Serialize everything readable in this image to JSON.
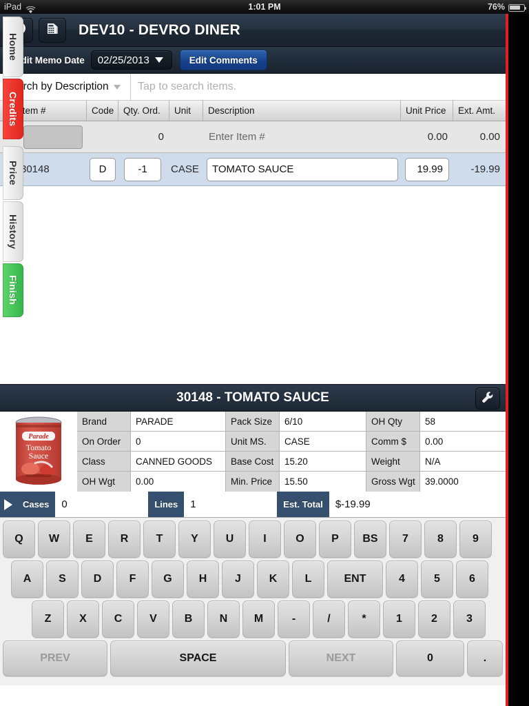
{
  "status_bar": {
    "carrier": "iPad",
    "wifi_icon": "wifi-icon",
    "time": "1:01 PM",
    "battery_percent": "76%",
    "battery_icon": "battery-icon"
  },
  "title_bar": {
    "info_icon": "info-icon",
    "calculator_icon": "calculator-icon",
    "title": "DEV10 - DEVRO DINER"
  },
  "sub_bar": {
    "date_label": "Credit Memo Date",
    "date_value": "02/25/2013",
    "dropdown_icon": "chevron-down-icon",
    "edit_comments_label": "Edit Comments"
  },
  "search": {
    "mode_label": "Search by Description",
    "mode_dropdown_icon": "chevron-down-icon",
    "placeholder": "Tap to search items.",
    "value": ""
  },
  "grid": {
    "columns": [
      {
        "key": "icon",
        "label": ""
      },
      {
        "key": "item",
        "label": "Item #"
      },
      {
        "key": "code",
        "label": "Code"
      },
      {
        "key": "qty",
        "label": "Qty. Ord."
      },
      {
        "key": "unit",
        "label": "Unit"
      },
      {
        "key": "desc",
        "label": "Description"
      },
      {
        "key": "price",
        "label": "Unit Price"
      },
      {
        "key": "ext",
        "label": "Ext. Amt."
      }
    ],
    "entry_row": {
      "item": "",
      "code": "",
      "qty": "0",
      "unit": "",
      "desc_placeholder": "Enter Item #",
      "price": "0.00",
      "ext": "0.00"
    },
    "rows": [
      {
        "row_icon": "package-icon",
        "item": "30148",
        "code": "D",
        "qty": "-1",
        "unit": "CASE",
        "desc": "TOMATO SAUCE",
        "price": "19.99",
        "ext": "-19.99"
      }
    ]
  },
  "detail": {
    "title": "30148 - TOMATO SAUCE",
    "wrench_icon": "wrench-icon",
    "product_image_alt": "Parade Tomato Sauce can",
    "specs": [
      {
        "label": "Brand",
        "value": "PARADE"
      },
      {
        "label": "Pack Size",
        "value": "6/10"
      },
      {
        "label": "OH Qty",
        "value": "58"
      },
      {
        "label": "On Order",
        "value": "0"
      },
      {
        "label": "Unit MS.",
        "value": "CASE"
      },
      {
        "label": "Comm $",
        "value": "0.00"
      },
      {
        "label": "Class",
        "value": "CANNED GOODS"
      },
      {
        "label": "Base Cost",
        "value": "15.20"
      },
      {
        "label": "Weight",
        "value": "N/A"
      },
      {
        "label": "OH Wgt",
        "value": "0.00"
      },
      {
        "label": "Min. Price",
        "value": "15.50"
      },
      {
        "label": "Gross Wgt",
        "value": "39.0000"
      }
    ]
  },
  "totals": {
    "expand_icon": "triangle-right-icon",
    "cases_label": "Cases",
    "cases_value": "0",
    "lines_label": "Lines",
    "lines_value": "1",
    "est_total_label": "Est. Total",
    "est_total_value": "$-19.99"
  },
  "keyboard": {
    "row1": [
      "Q",
      "W",
      "E",
      "R",
      "T",
      "Y",
      "U",
      "I",
      "O",
      "P",
      "BS",
      "7",
      "8",
      "9"
    ],
    "row2": [
      "A",
      "S",
      "D",
      "F",
      "G",
      "H",
      "J",
      "K",
      "L",
      "ENT",
      "4",
      "5",
      "6"
    ],
    "row3": [
      "Z",
      "X",
      "C",
      "V",
      "B",
      "N",
      "M",
      "-",
      "/",
      "*",
      "1",
      "2",
      "3"
    ],
    "row4": [
      "PREV",
      "SPACE",
      "NEXT",
      "0",
      "."
    ]
  },
  "side_tabs": [
    {
      "label": "Home",
      "style": "light"
    },
    {
      "label": "Credits",
      "style": "redbg"
    },
    {
      "label": "Price",
      "style": "light"
    },
    {
      "label": "History",
      "style": "light"
    },
    {
      "label": "Finish",
      "style": "green"
    }
  ],
  "colors": {
    "header_navy": "#243140",
    "accent_blue": "#1b4b93",
    "selected_row": "#cfdcec",
    "tab_red": "#e0261f",
    "tab_green": "#34b64a",
    "edge_red": "#e02020"
  }
}
